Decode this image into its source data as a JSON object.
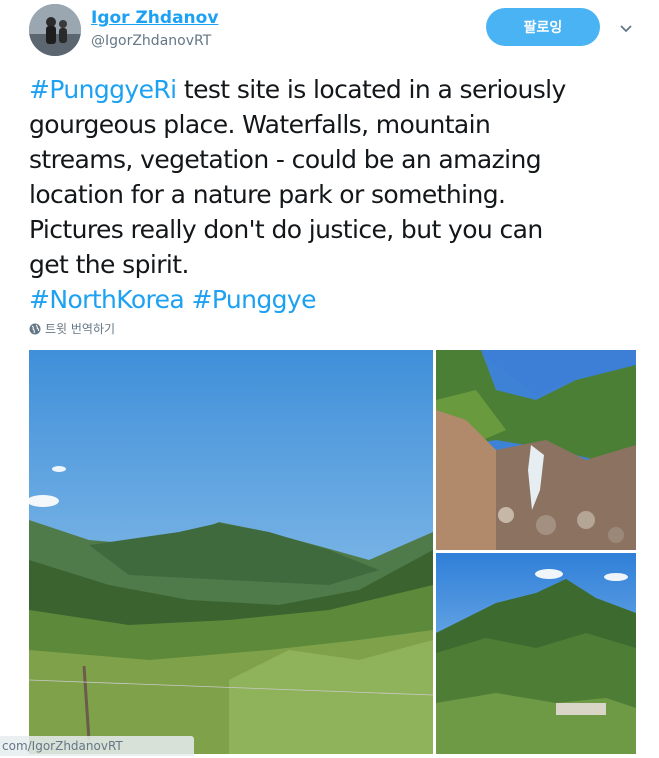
{
  "user": {
    "display_name": "Igor Zhdanov",
    "handle": "@IgorZhdanovRT",
    "avatar_icon": "avatar-photo"
  },
  "follow_button": {
    "label": "팔로잉"
  },
  "menu_caret": {
    "icon": "chevron-down-icon"
  },
  "tweet": {
    "lines": [
      [
        {
          "text": "#PunggyeRi",
          "tag": true
        },
        {
          "text": " test site is located in a seriously",
          "tag": false
        }
      ],
      [
        {
          "text": "gourgeous place.  Waterfalls, mountain",
          "tag": false
        }
      ],
      [
        {
          "text": "streams, vegetation - could be an amazing",
          "tag": false
        }
      ],
      [
        {
          "text": "location  for a nature park or something.",
          "tag": false
        }
      ],
      [
        {
          "text": "Pictures really don't do justice, but  you can",
          "tag": false
        }
      ],
      [
        {
          "text": "get the spirit.",
          "tag": false
        }
      ],
      [
        {
          "text": "#NorthKorea",
          "tag": true
        },
        {
          "text": " ",
          "tag": false
        },
        {
          "text": "#Punggye",
          "tag": true
        }
      ]
    ]
  },
  "translate": {
    "label": "트윗 번역하기",
    "icon": "globe-icon"
  },
  "media": {
    "photos": [
      "mountain-valley-photo",
      "waterfall-stream-photo",
      "green-peak-photo"
    ]
  },
  "url_overlay": {
    "text": "com/IgorZhdanovRT"
  },
  "colors": {
    "accent": "#1da1f2",
    "follow_bg": "#4ab3f4",
    "secondary_text": "#657786"
  }
}
